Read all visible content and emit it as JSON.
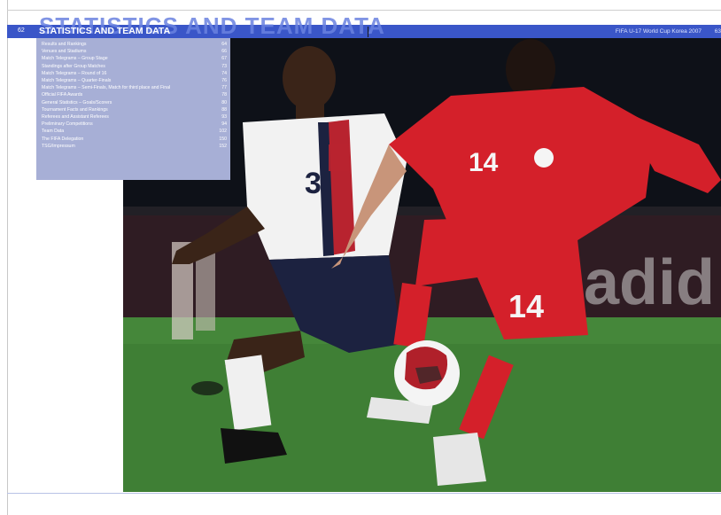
{
  "header": {
    "page_left": "62",
    "title": "STATISTICS AND TEAM DATA",
    "watermark": "STATISTICS AND TEAM DATA",
    "publication": "FIFA U-17 World Cup Korea 2007",
    "page_right": "63"
  },
  "toc": [
    {
      "label": "Results and Rankings",
      "page": "64"
    },
    {
      "label": "Venues and Stadiums",
      "page": "66"
    },
    {
      "label": "Match Telegrams – Group Stage",
      "page": "67"
    },
    {
      "label": "Standings after Group Matches",
      "page": "73"
    },
    {
      "label": "Match Telegrams – Round of 16",
      "page": "74"
    },
    {
      "label": "Match Telegrams – Quarter-Finals",
      "page": "76"
    },
    {
      "label": "Match Telegrams – Semi-Finals, Match for third place and Final",
      "page": "77"
    },
    {
      "label": "Official FIFA Awards",
      "page": "78"
    },
    {
      "label": "General Statistics – Goals/Scorers",
      "page": "80"
    },
    {
      "label": "Tournament Facts and Rankings",
      "page": "88"
    },
    {
      "label": "Referees and Assistant Referees",
      "page": "93"
    },
    {
      "label": "Preliminary Competitions",
      "page": "94"
    },
    {
      "label": "Team Data",
      "page": "102"
    },
    {
      "label": "The FIFA Delegation",
      "page": "150"
    },
    {
      "label": "TSG/Impressum",
      "page": "152"
    }
  ],
  "photo": {
    "jersey_left": "3",
    "jersey_right_chest": "14",
    "jersey_right_shorts": "14",
    "ad_board": "adid"
  },
  "colors": {
    "header_blue": "#3a56c8",
    "toc_bg": "#a7afd6",
    "kit_red": "#d4202a",
    "kit_white": "#f2f2f2",
    "kit_navy": "#1c2240"
  }
}
